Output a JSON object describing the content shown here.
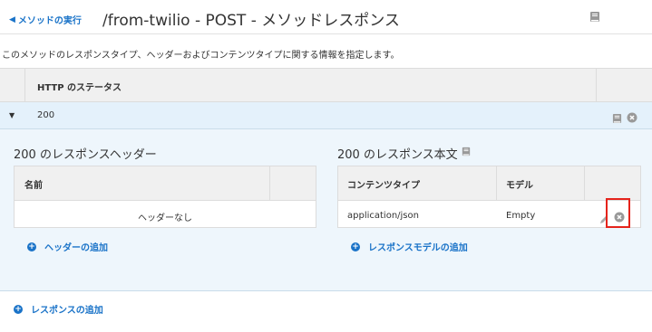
{
  "header": {
    "back_label": "メソッドの実行",
    "title": "/from-twilio - POST - メソッドレスポンス"
  },
  "description": "このメソッドのレスポンスタイプ、ヘッダーおよびコンテンツタイプに関する情報を指定します。",
  "status_table": {
    "column_header": "HTTP のステータス",
    "rows": [
      {
        "status": "200"
      }
    ]
  },
  "headers_section": {
    "title": "200 のレスポンスヘッダー",
    "column_name": "名前",
    "empty_text": "ヘッダーなし",
    "add_label": "ヘッダーの追加"
  },
  "body_section": {
    "title": "200 のレスポンス本文",
    "column_content_type": "コンテンツタイプ",
    "column_model": "モデル",
    "rows": [
      {
        "content_type": "application/json",
        "model": "Empty"
      }
    ],
    "add_label": "レスポンスモデルの追加"
  },
  "footer": {
    "add_response_label": "レスポンスの追加"
  },
  "colors": {
    "link": "#1a73c8",
    "panel_bg": "#eef6fc",
    "highlight": "#e5231b"
  }
}
